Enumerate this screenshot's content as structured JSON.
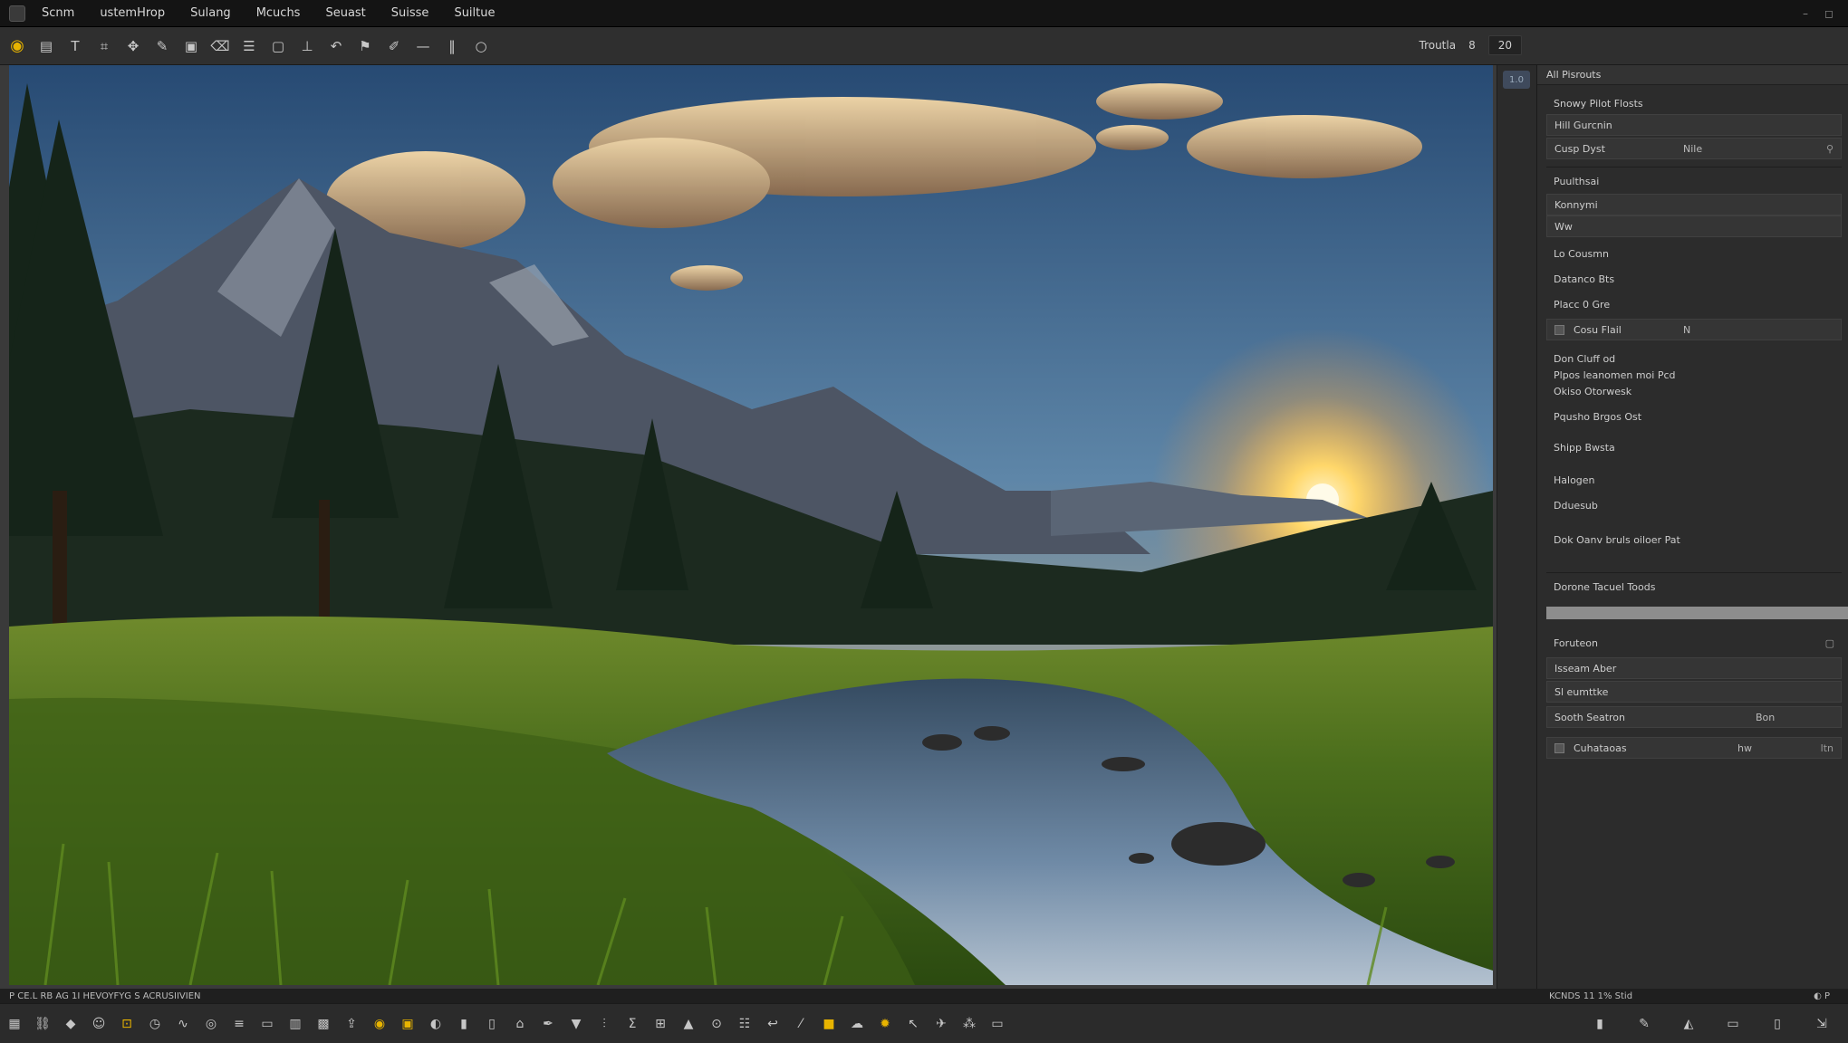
{
  "menubar": {
    "items": [
      "Scnm",
      "ustemHrop",
      "Sulang",
      "Mcuchs",
      "Seuast",
      "Suisse",
      "Suiltue"
    ],
    "window_controls": [
      "–",
      "◻"
    ]
  },
  "toolbar": {
    "tools": [
      "select-icon",
      "layers-icon",
      "text-icon",
      "crop-icon",
      "move-icon",
      "brush-icon",
      "image-icon",
      "eraser-icon",
      "list-icon",
      "frame-icon",
      "pin-icon",
      "undo-icon",
      "flag-icon",
      "pen-icon",
      "line-icon",
      "pause-icon",
      "circle-icon"
    ],
    "zoom_label": "Troutla",
    "zoom_value": "8",
    "zoom_extra": "20"
  },
  "canvas": {
    "scroll_handle": "1.0"
  },
  "panel": {
    "header": "All Pisrouts",
    "section1_title": "Snowy Pilot Flosts",
    "field1": "Hill Gurcnin",
    "field2_label": "Cusp Dyst",
    "field2_value": "Nile",
    "section2_title": "Puulthsai",
    "field3": "Konnymi",
    "field4": "Ww",
    "row1": "Lo Cousmn",
    "row2": "Datanco Bts",
    "row3": "Placc 0 Gre",
    "field5_label": "Cosu Flail",
    "field5_value": "N",
    "row4": "Don Cluff od",
    "row5": "Plpos leanomen moi Pcd",
    "row6": "Okiso Otorwesk",
    "row7": "Pqusho Brgos Ost",
    "row8": "Shipp Bwsta",
    "row9": "Halogen",
    "row10": "Dduesub",
    "row11": "Dok Oanv bruls oiloer Pat",
    "row12": "Dorone Tacuel Toods",
    "progress": 1.0,
    "section3_title": "Foruteon",
    "list1": "Isseam Aber",
    "list2": "Sl eumttke",
    "list3_label": "Sooth Seatron",
    "list3_value": "Bon",
    "list4_label": "Cuhataoas",
    "list4_value": "hw",
    "list4_end": "ltn",
    "status": "KCNDS 11 1% Stid"
  },
  "statusbar": {
    "left": "P  CE.L  RB  AG  1I HEVOYFYG S ACRUSIIVIEN",
    "right": "◐ P"
  },
  "bottombar": {
    "tools": [
      "grid-icon",
      "link-icon",
      "shape-icon",
      "person-icon",
      "lock-icon",
      "clock-icon",
      "wave-icon",
      "eye-icon",
      "lines-icon",
      "box-icon",
      "table-icon",
      "grid2-icon",
      "share-icon",
      "target-icon",
      "frame2-icon",
      "palette-icon",
      "stats-icon",
      "doc-icon",
      "nav-icon",
      "pen2-icon",
      "shield-icon",
      "bars-icon",
      "sigma-icon",
      "image2-icon",
      "film-icon",
      "cycle-icon",
      "menu-icon",
      "hook-icon",
      "spark-icon",
      "star-icon",
      "cloud-icon",
      "fire-icon",
      "pointer-icon",
      "pin2-icon",
      "cluster-icon",
      "monitor-icon"
    ],
    "right_tools": [
      "trash-icon",
      "brush2-icon",
      "drop-icon",
      "folder-icon",
      "doc2-icon",
      "export-icon"
    ]
  },
  "colors": {
    "accent": "#e8b400",
    "bg": "#262626",
    "panel": "#2c2c2c"
  }
}
